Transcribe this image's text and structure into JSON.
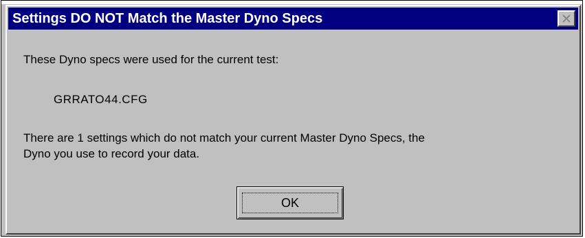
{
  "dialog": {
    "title": "Settings DO NOT Match the Master Dyno Specs",
    "close_icon": "close-icon",
    "intro_text": "These Dyno specs were used for the current test:",
    "config_file": "GRRATO44.CFG",
    "mismatch_line1": "There are 1 settings which do not match your current Master Dyno Specs, the",
    "mismatch_line2": "Dyno you use to record your data.",
    "ok_label": "OK"
  },
  "colors": {
    "title_bar": "#000080",
    "dialog_face": "#c0c0c0",
    "title_text": "#ffffff"
  }
}
